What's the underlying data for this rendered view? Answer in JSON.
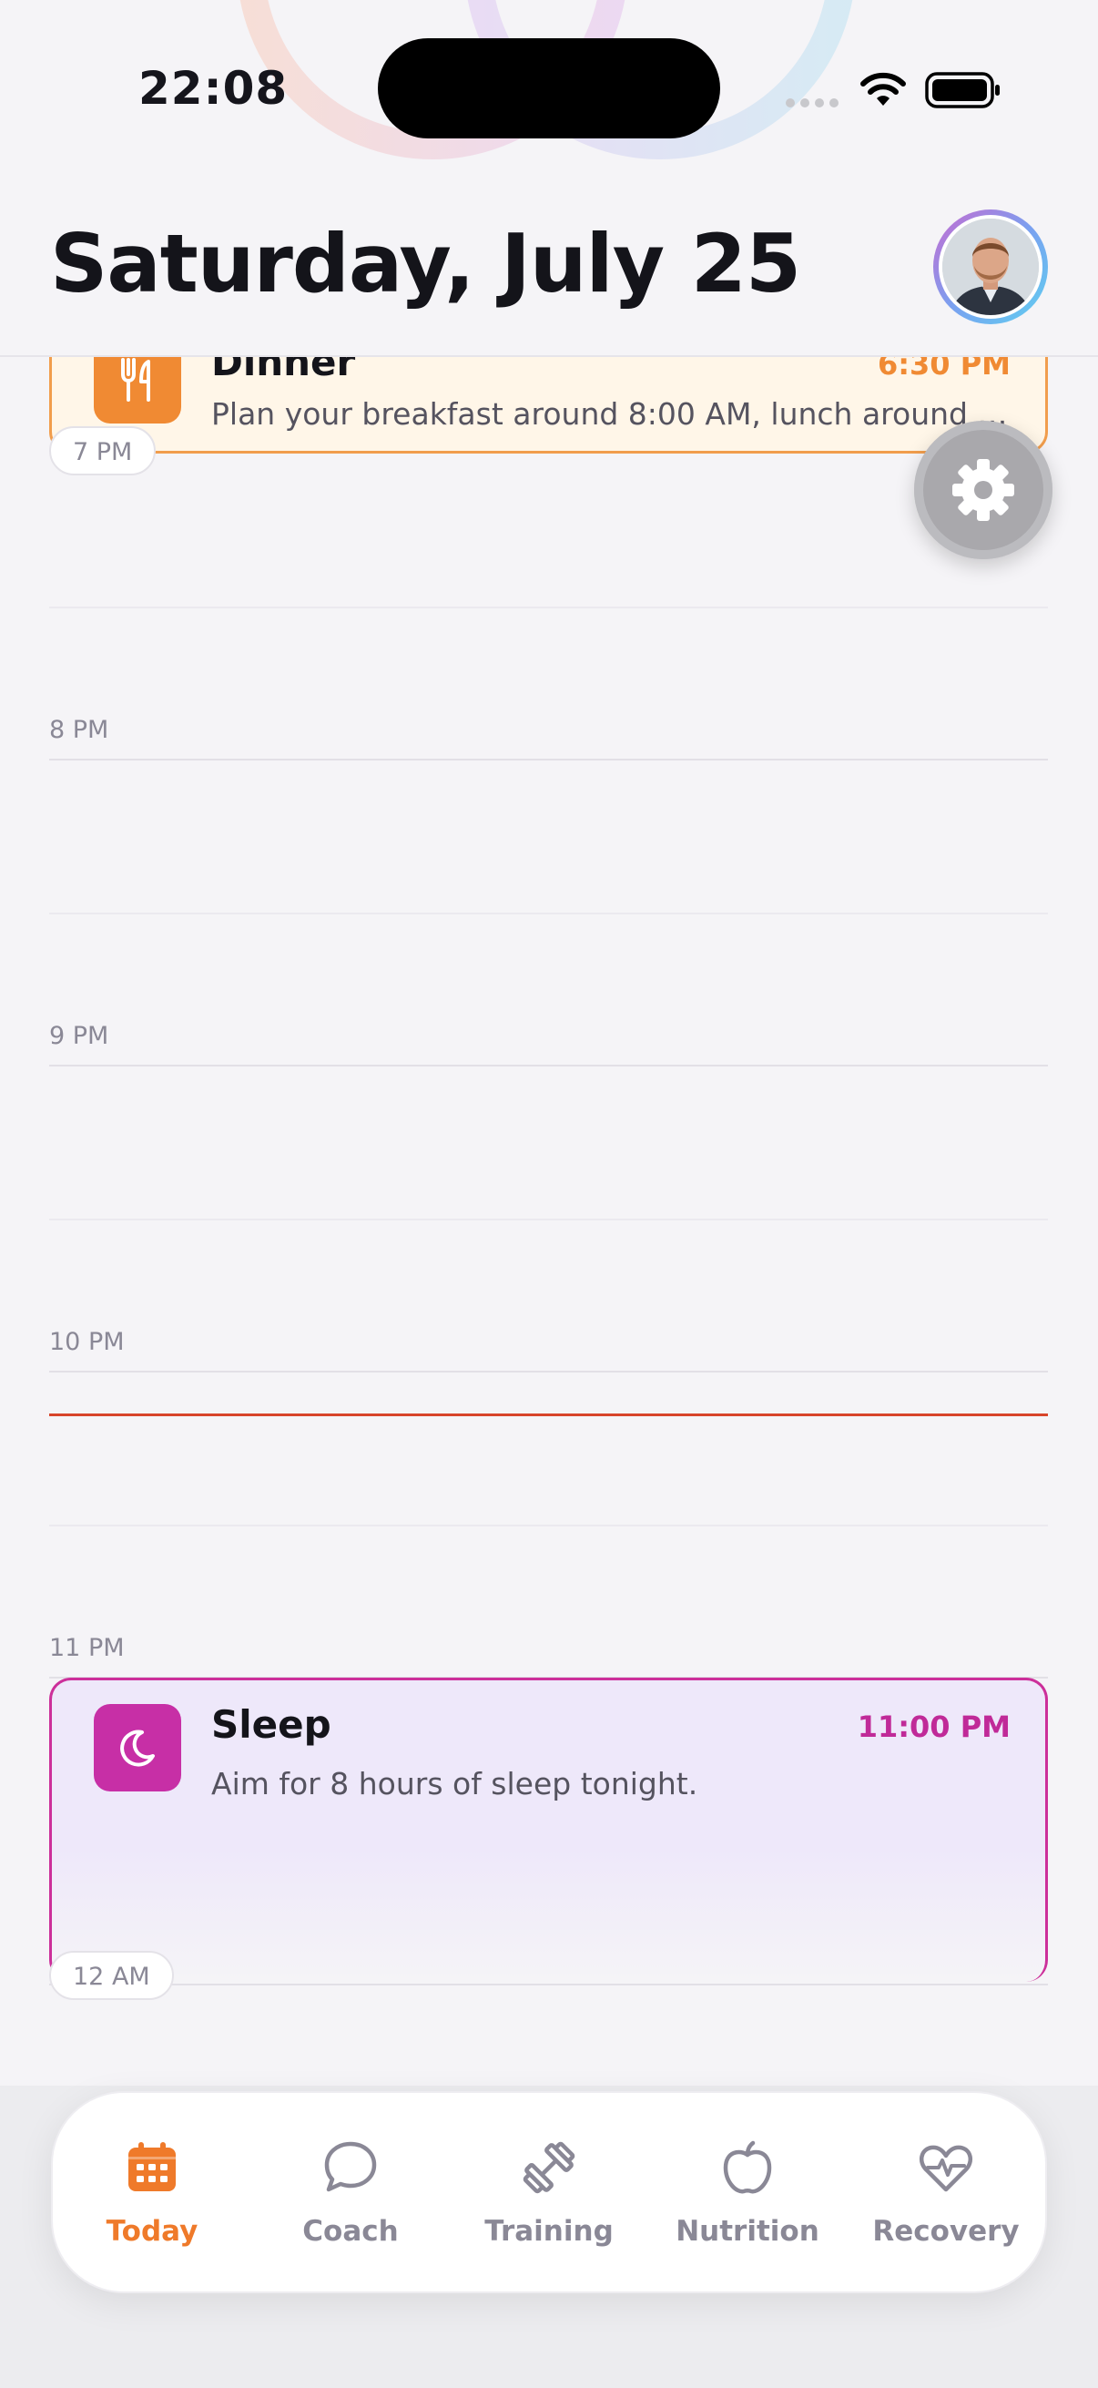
{
  "status_bar": {
    "time": "22:08"
  },
  "header": {
    "title": "Saturday, July 25"
  },
  "timeline": {
    "hours": [
      {
        "label": "7 PM",
        "pill": true
      },
      {
        "label": "8 PM",
        "pill": false
      },
      {
        "label": "9 PM",
        "pill": false
      },
      {
        "label": "10 PM",
        "pill": false
      },
      {
        "label": "11 PM",
        "pill": false
      },
      {
        "label": "12 AM",
        "pill": true
      }
    ]
  },
  "events": {
    "dinner": {
      "title": "Dinner",
      "time": "6:30 PM",
      "description": "Plan your breakfast around 8:00 AM, lunch around 1...",
      "icon": "fork-knife-icon",
      "color": "#f08a33"
    },
    "sleep": {
      "title": "Sleep",
      "time": "11:00 PM",
      "description": "Aim for 8 hours of sleep tonight.",
      "icon": "moon-icon",
      "color": "#c72fa6"
    }
  },
  "tabs": [
    {
      "label": "Today",
      "icon": "calendar-icon",
      "active": true
    },
    {
      "label": "Coach",
      "icon": "chat-bubble-icon",
      "active": false
    },
    {
      "label": "Training",
      "icon": "dumbbell-icon",
      "active": false
    },
    {
      "label": "Nutrition",
      "icon": "apple-icon",
      "active": false
    },
    {
      "label": "Recovery",
      "icon": "heart-pulse-icon",
      "active": false
    }
  ],
  "colors": {
    "accent": "#ef7a2a",
    "now_line": "#d8452a",
    "sleep": "#c72fa6",
    "dinner": "#f08a33"
  }
}
